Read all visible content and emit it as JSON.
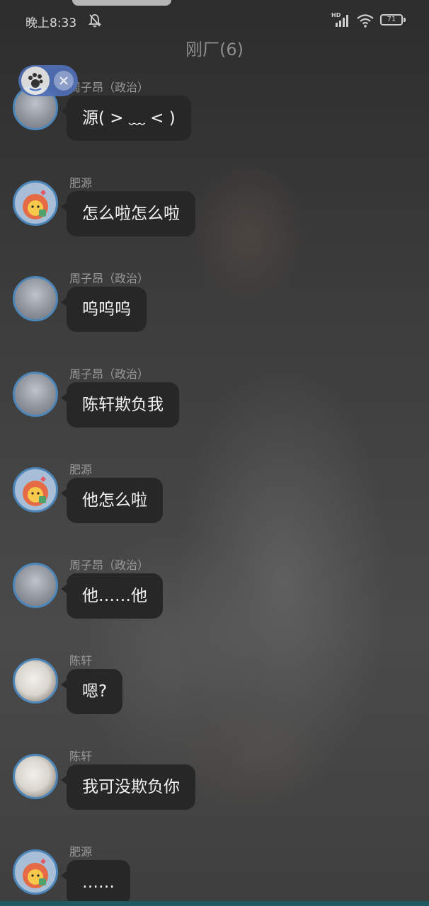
{
  "status_bar": {
    "time": "晚上8:33",
    "network_label": "HD",
    "battery": "71"
  },
  "chat": {
    "title": "刚厂(6)"
  },
  "floating_pill": {
    "close_glyph": "×",
    "icon": "paw-icon"
  },
  "messages": [
    {
      "sender": "周子昂（政治）",
      "text": "源( > ﹏ < )",
      "avatar": "zhou"
    },
    {
      "sender": "肥源",
      "text": "怎么啦怎么啦",
      "avatar": "fei"
    },
    {
      "sender": "周子昂（政治）",
      "text": "呜呜呜",
      "avatar": "zhou"
    },
    {
      "sender": "周子昂（政治）",
      "text": "陈轩欺负我",
      "avatar": "zhou"
    },
    {
      "sender": "肥源",
      "text": "他怎么啦",
      "avatar": "fei"
    },
    {
      "sender": "周子昂（政治）",
      "text": "他……他",
      "avatar": "zhou"
    },
    {
      "sender": "陈轩",
      "text": "嗯?",
      "avatar": "chen"
    },
    {
      "sender": "陈轩",
      "text": "我可没欺负你",
      "avatar": "chen"
    },
    {
      "sender": "肥源",
      "text": "……",
      "avatar": "fei"
    }
  ],
  "colors": {
    "bubble_bg": "#272727",
    "avatar_ring": "#4d86b9",
    "pill_bg": "#4f6fb7",
    "bottom_strip": "#1f5962"
  }
}
